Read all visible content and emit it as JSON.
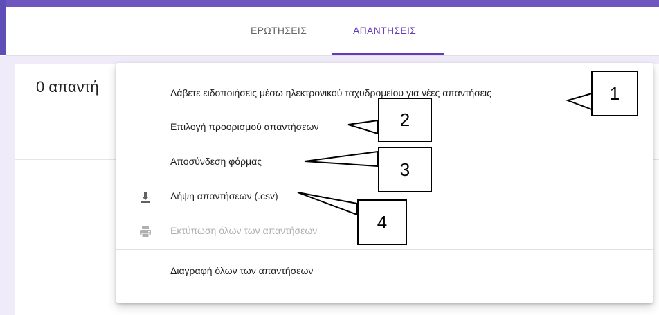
{
  "tabs": [
    {
      "label": "ΕΡΩΤΗΣΕΙΣ",
      "active": false
    },
    {
      "label": "ΑΠΑΝΤΗΣΕΙΣ",
      "active": true
    }
  ],
  "main": {
    "responses_count": "0 απαντή"
  },
  "menu": {
    "items": [
      {
        "label": "Λάβετε ειδοποιήσεις μέσω ηλεκτρονικού ταχυδρομείου για νέες απαντήσεις",
        "icon": "",
        "enabled": true
      },
      {
        "label": "Επιλογή προορισμού απαντήσεων",
        "icon": "",
        "enabled": true
      },
      {
        "label": "Αποσύνδεση φόρμας",
        "icon": "",
        "enabled": true
      },
      {
        "label": "Λήψη απαντήσεων (.csv)",
        "icon": "download-icon",
        "enabled": true
      },
      {
        "label": "Εκτύπωση όλων των απαντήσεων",
        "icon": "print-icon",
        "enabled": false
      },
      {
        "label": "Διαγραφή όλων των απαντήσεων",
        "icon": "",
        "enabled": true
      }
    ]
  },
  "callouts": [
    {
      "number": "1"
    },
    {
      "number": "2"
    },
    {
      "number": "3"
    },
    {
      "number": "4"
    }
  ],
  "colors": {
    "accent": "#673ab7",
    "background": "#f0ebf8",
    "disabled_text": "#b0b0b0"
  }
}
